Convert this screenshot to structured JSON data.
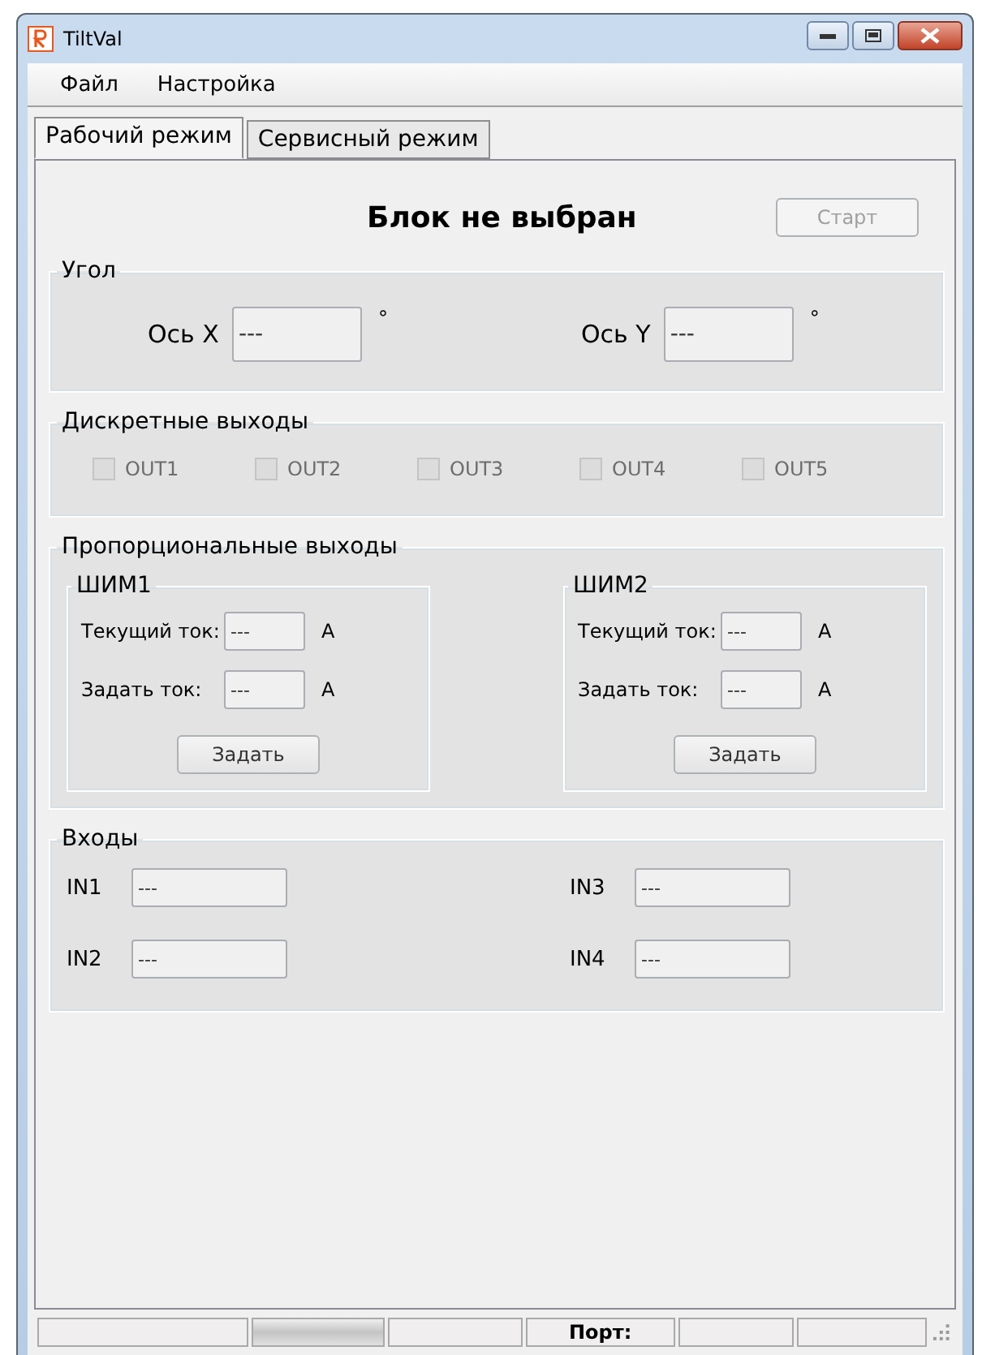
{
  "window": {
    "title": "TiltVal"
  },
  "menu": [
    "Файл",
    "Настройка"
  ],
  "tabs": [
    {
      "label": "Рабочий режим",
      "selected": true
    },
    {
      "label": "Сервисный режим",
      "selected": false
    }
  ],
  "header": {
    "status": "Блок не выбран",
    "start_button": {
      "label": "Старт",
      "disabled": true
    }
  },
  "angle": {
    "title": "Угол",
    "axes": [
      {
        "label": "Ось X",
        "value": "---",
        "unit": "°"
      },
      {
        "label": "Ось Y",
        "value": "---",
        "unit": "°"
      }
    ]
  },
  "discrete_outputs": {
    "title": "Дискретные выходы",
    "items": [
      {
        "label": "OUT1",
        "checked": false,
        "disabled": true
      },
      {
        "label": "OUT2",
        "checked": false,
        "disabled": true
      },
      {
        "label": "OUT3",
        "checked": false,
        "disabled": true
      },
      {
        "label": "OUT4",
        "checked": false,
        "disabled": true
      },
      {
        "label": "OUT5",
        "checked": false,
        "disabled": true
      }
    ]
  },
  "proportional_outputs": {
    "title": "Пропорциональные выходы",
    "channels": [
      {
        "title": "ШИМ1",
        "current_label": "Текущий ток:",
        "current_value": "---",
        "current_unit": "А",
        "set_label": "Задать ток:",
        "set_value": "---",
        "set_unit": "А",
        "button": "Задать"
      },
      {
        "title": "ШИМ2",
        "current_label": "Текущий ток:",
        "current_value": "---",
        "current_unit": "А",
        "set_label": "Задать ток:",
        "set_value": "---",
        "set_unit": "А",
        "button": "Задать"
      }
    ]
  },
  "inputs": {
    "title": "Входы",
    "items": [
      {
        "label": "IN1",
        "value": "---"
      },
      {
        "label": "IN3",
        "value": "---"
      },
      {
        "label": "IN2",
        "value": "---"
      },
      {
        "label": "IN4",
        "value": "---"
      }
    ]
  },
  "status_bar": [
    {
      "kind": "text"
    },
    {
      "kind": "progress",
      "level": 1
    },
    {
      "kind": "text"
    },
    {
      "kind": "text",
      "text": "Порт:"
    },
    {
      "kind": "text"
    },
    {
      "kind": "text"
    }
  ]
}
